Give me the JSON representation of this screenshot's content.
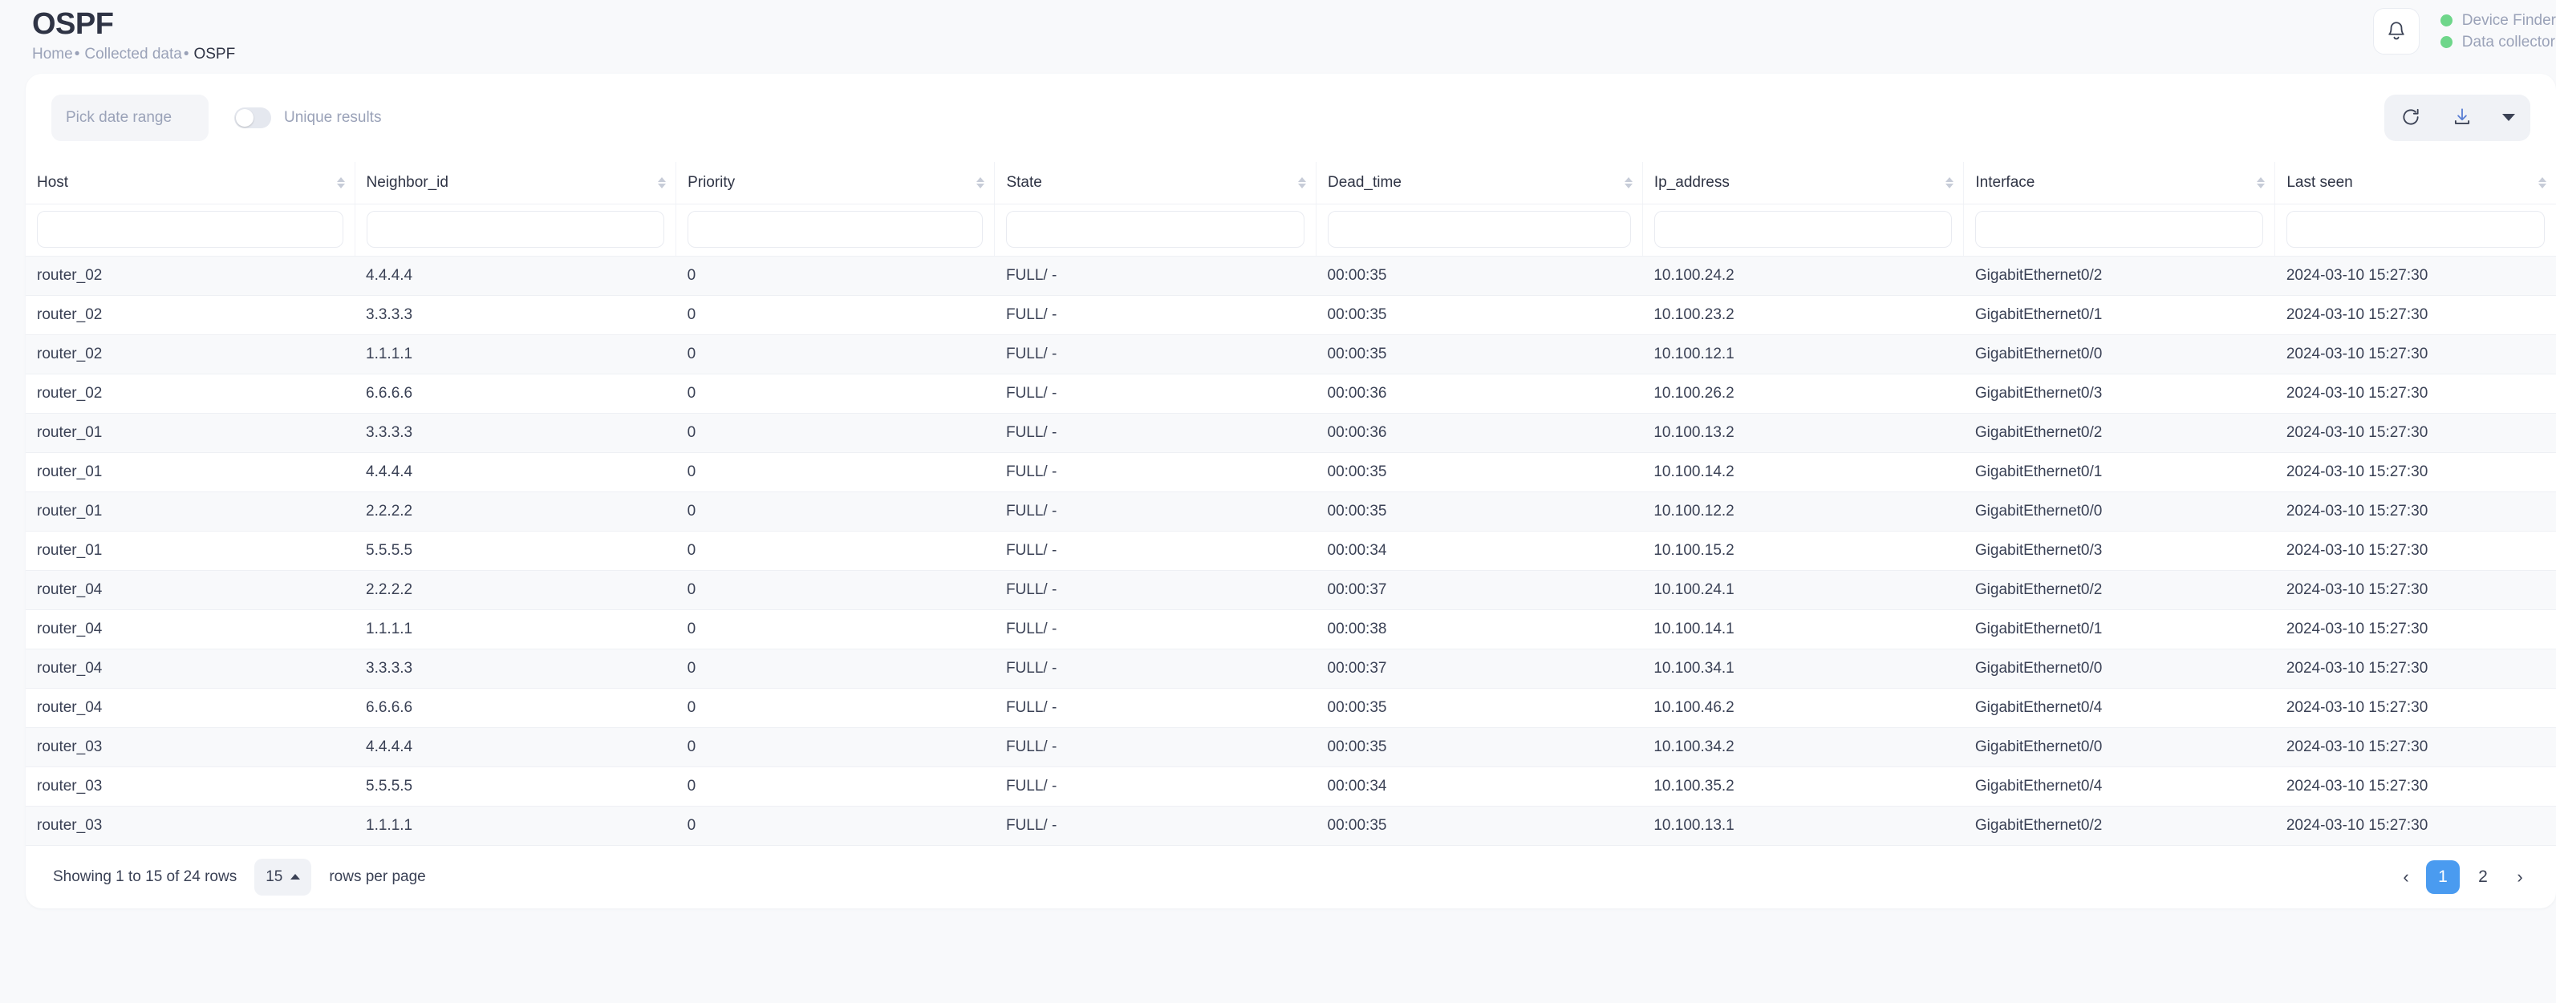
{
  "header": {
    "title": "OSPF",
    "breadcrumb": [
      {
        "label": "Home",
        "current": false
      },
      {
        "label": "Collected data",
        "current": false
      },
      {
        "label": "OSPF",
        "current": true
      }
    ],
    "separator": "•",
    "notifications_icon": "bell-icon",
    "statuses": [
      {
        "label": "Device Finder",
        "color": "#6ed68a"
      },
      {
        "label": "Data collector",
        "color": "#6ed68a"
      }
    ]
  },
  "toolbar": {
    "date_range_placeholder": "Pick date range",
    "date_range_value": "",
    "unique_results_label": "Unique results",
    "unique_results_on": false,
    "refresh_icon": "refresh-icon",
    "download_icon": "download-icon",
    "dropdown_caret": "▾"
  },
  "table": {
    "columns": [
      {
        "label": "Host",
        "width": "13.0%",
        "filter": ""
      },
      {
        "label": "Neighbor_id",
        "width": "12.7%",
        "filter": ""
      },
      {
        "label": "Priority",
        "width": "12.6%",
        "filter": ""
      },
      {
        "label": "State",
        "width": "12.7%",
        "filter": ""
      },
      {
        "label": "Dead_time",
        "width": "12.9%",
        "filter": ""
      },
      {
        "label": "Ip_address",
        "width": "12.7%",
        "filter": ""
      },
      {
        "label": "Interface",
        "width": "12.3%",
        "filter": ""
      },
      {
        "label": "Last seen",
        "width": "11.1%",
        "filter": ""
      }
    ],
    "rows": [
      [
        "router_02",
        "4.4.4.4",
        "0",
        "FULL/ -",
        "00:00:35",
        "10.100.24.2",
        "GigabitEthernet0/2",
        "2024-03-10 15:27:30"
      ],
      [
        "router_02",
        "3.3.3.3",
        "0",
        "FULL/ -",
        "00:00:35",
        "10.100.23.2",
        "GigabitEthernet0/1",
        "2024-03-10 15:27:30"
      ],
      [
        "router_02",
        "1.1.1.1",
        "0",
        "FULL/ -",
        "00:00:35",
        "10.100.12.1",
        "GigabitEthernet0/0",
        "2024-03-10 15:27:30"
      ],
      [
        "router_02",
        "6.6.6.6",
        "0",
        "FULL/ -",
        "00:00:36",
        "10.100.26.2",
        "GigabitEthernet0/3",
        "2024-03-10 15:27:30"
      ],
      [
        "router_01",
        "3.3.3.3",
        "0",
        "FULL/ -",
        "00:00:36",
        "10.100.13.2",
        "GigabitEthernet0/2",
        "2024-03-10 15:27:30"
      ],
      [
        "router_01",
        "4.4.4.4",
        "0",
        "FULL/ -",
        "00:00:35",
        "10.100.14.2",
        "GigabitEthernet0/1",
        "2024-03-10 15:27:30"
      ],
      [
        "router_01",
        "2.2.2.2",
        "0",
        "FULL/ -",
        "00:00:35",
        "10.100.12.2",
        "GigabitEthernet0/0",
        "2024-03-10 15:27:30"
      ],
      [
        "router_01",
        "5.5.5.5",
        "0",
        "FULL/ -",
        "00:00:34",
        "10.100.15.2",
        "GigabitEthernet0/3",
        "2024-03-10 15:27:30"
      ],
      [
        "router_04",
        "2.2.2.2",
        "0",
        "FULL/ -",
        "00:00:37",
        "10.100.24.1",
        "GigabitEthernet0/2",
        "2024-03-10 15:27:30"
      ],
      [
        "router_04",
        "1.1.1.1",
        "0",
        "FULL/ -",
        "00:00:38",
        "10.100.14.1",
        "GigabitEthernet0/1",
        "2024-03-10 15:27:30"
      ],
      [
        "router_04",
        "3.3.3.3",
        "0",
        "FULL/ -",
        "00:00:37",
        "10.100.34.1",
        "GigabitEthernet0/0",
        "2024-03-10 15:27:30"
      ],
      [
        "router_04",
        "6.6.6.6",
        "0",
        "FULL/ -",
        "00:00:35",
        "10.100.46.2",
        "GigabitEthernet0/4",
        "2024-03-10 15:27:30"
      ],
      [
        "router_03",
        "4.4.4.4",
        "0",
        "FULL/ -",
        "00:00:35",
        "10.100.34.2",
        "GigabitEthernet0/0",
        "2024-03-10 15:27:30"
      ],
      [
        "router_03",
        "5.5.5.5",
        "0",
        "FULL/ -",
        "00:00:34",
        "10.100.35.2",
        "GigabitEthernet0/4",
        "2024-03-10 15:27:30"
      ],
      [
        "router_03",
        "1.1.1.1",
        "0",
        "FULL/ -",
        "00:00:35",
        "10.100.13.1",
        "GigabitEthernet0/2",
        "2024-03-10 15:27:30"
      ]
    ]
  },
  "footer": {
    "showing_text": "Showing 1 to 15 of 24 rows",
    "rows_per_page_value": "15",
    "rows_per_page_label": "rows per page",
    "pagination": {
      "prev": "‹",
      "next": "›",
      "pages": [
        "1",
        "2"
      ],
      "active_page": "1",
      "active_color": "#4a9bf0"
    }
  }
}
